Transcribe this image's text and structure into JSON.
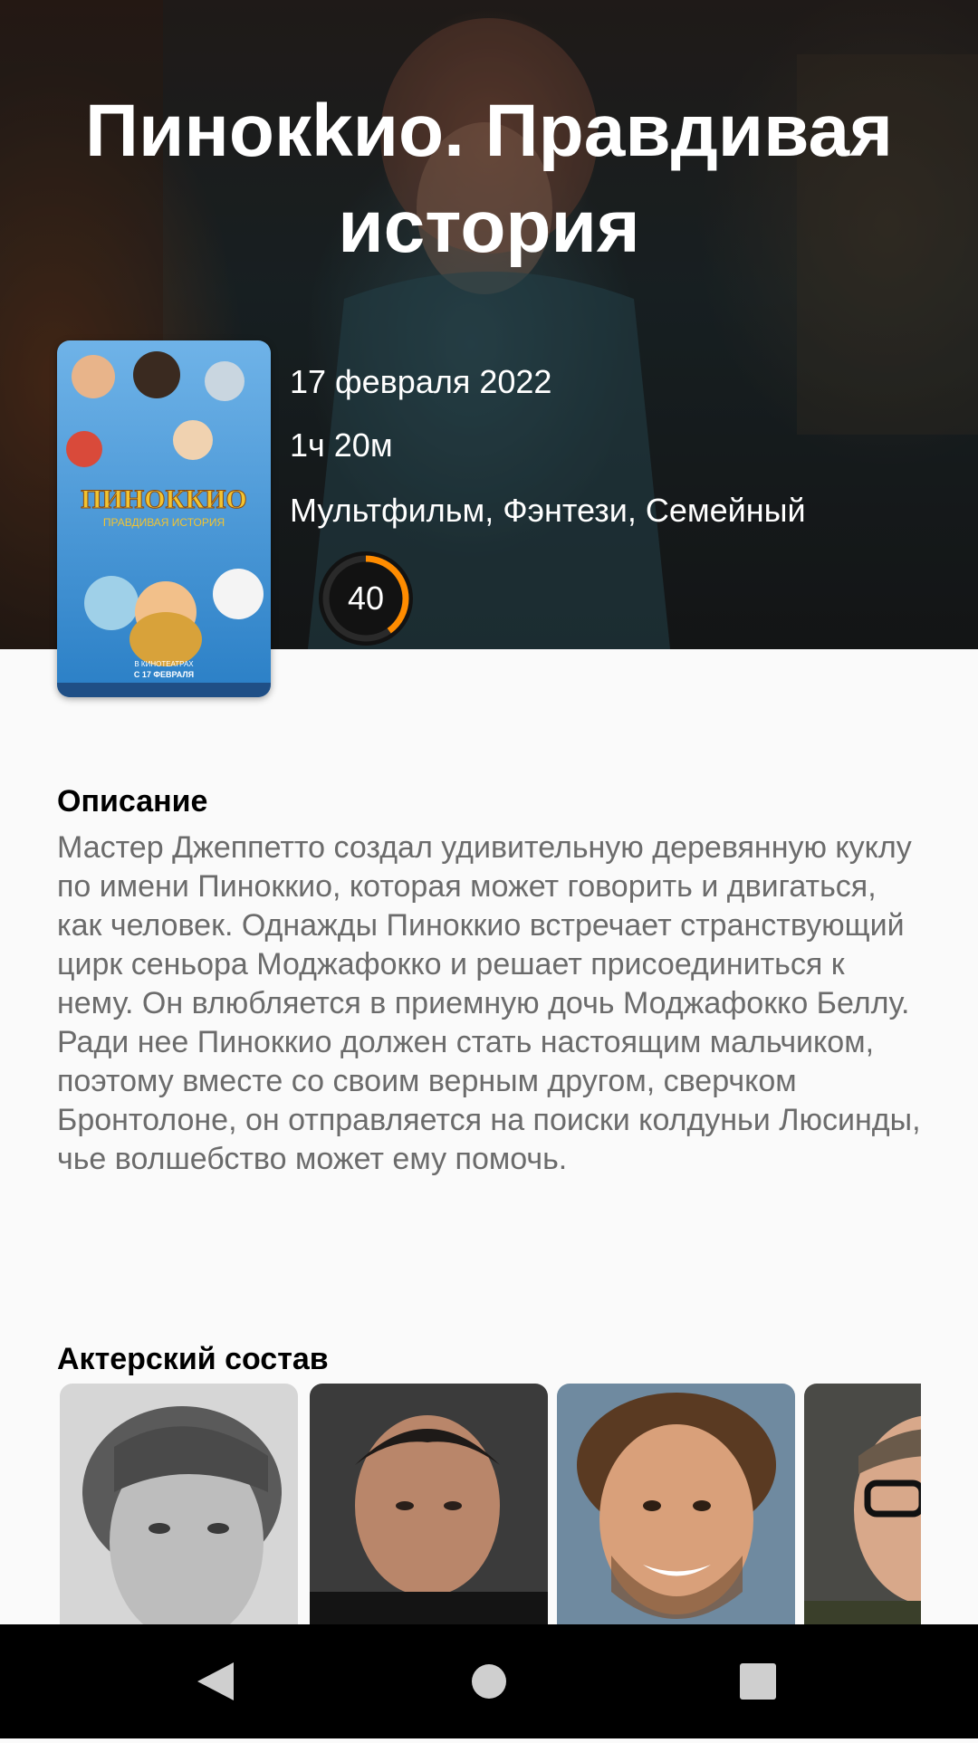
{
  "movie": {
    "title": "Пинокkио. Правдивая история",
    "release_date": "17 февраля 2022",
    "duration": "1ч 20м",
    "genres": "Мультфильм, Фэнтези, Семейный",
    "rating": "40",
    "rating_fraction": 0.4,
    "rating_color": "#ff8c00"
  },
  "poster": {
    "title_line1": "ПИНОККИО",
    "title_line2": "ПРАВДИВАЯ ИСТОРИЯ",
    "tagline_line1": "В КИНОТЕАТРАХ",
    "tagline_line2": "С 17 ФЕВРАЛЯ"
  },
  "description": {
    "heading": "Описание",
    "text": "Мастер Джеппетто создал удивительную деревянную куклу по имени Пиноккио, которая может говорить и двигаться, как человек. Однажды Пиноккио встречает странствующий цирк сеньора Моджафокко и решает присоединиться к нему. Он влюбляется в приемную дочь Моджафокко Беллу. Ради нее Пиноккио должен стать настоящим мальчиком, поэтому вместе со своим верным другом, сверчком Бронтолоне, он отправляется на поиски колдуньи Люсинды, чье волшебство может ему помочь."
  },
  "cast": {
    "heading": "Актерский состав"
  },
  "navbar": {
    "back_icon": "back-triangle-icon",
    "home_icon": "home-circle-icon",
    "recents_icon": "recents-square-icon"
  }
}
